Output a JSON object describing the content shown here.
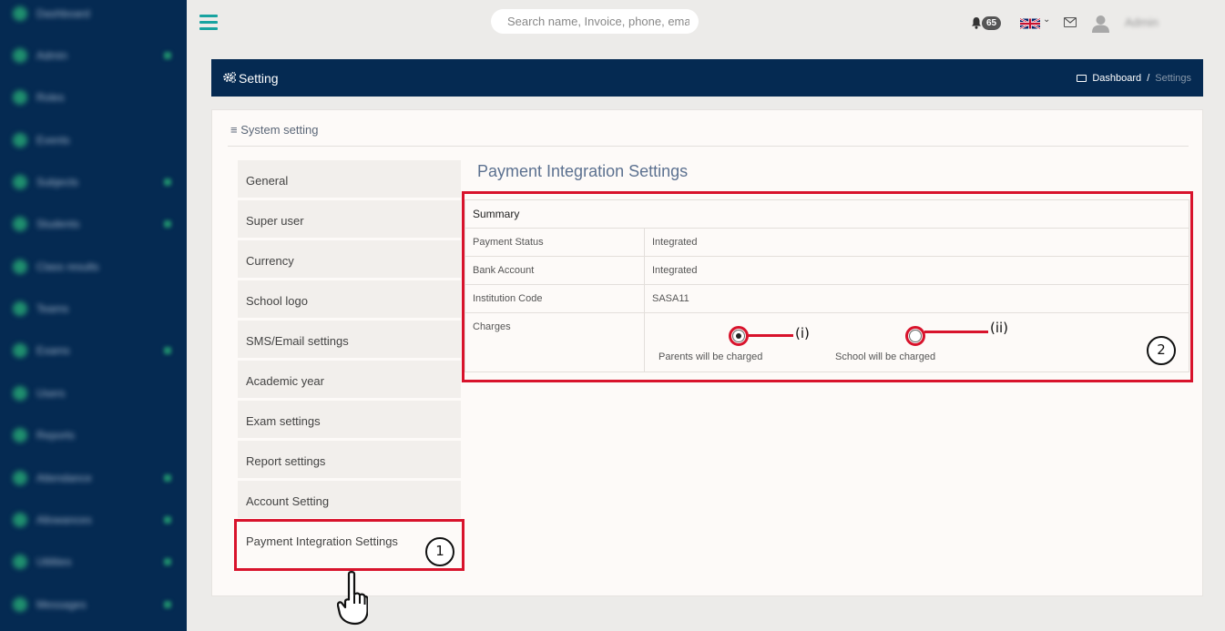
{
  "topbar": {
    "search_placeholder": "Search name, Invoice, phone, ema",
    "notification_count": "65",
    "user": "Admin"
  },
  "sidebar_items": [
    "Dashboard",
    "Admin",
    "Roles",
    "Events",
    "Subjects",
    "Students",
    "Class results",
    "Teams",
    "Exams",
    "Users",
    "Reports",
    "Attendance",
    "Allowances",
    "Utilities",
    "Messages"
  ],
  "header": {
    "title": "Setting",
    "breadcrumb_home": "Dashboard",
    "breadcrumb_sep": "/",
    "breadcrumb_current": "Settings"
  },
  "panel": {
    "title": "System setting"
  },
  "menu": [
    "General",
    "Super user",
    "Currency",
    "School logo",
    "SMS/Email settings",
    "Academic year",
    "Exam settings",
    "Report settings",
    "Account Setting",
    "Payment Integration Settings"
  ],
  "content": {
    "title": "Payment Integration Settings",
    "summary": "Summary",
    "rows": [
      {
        "label": "Payment Status",
        "value": "Integrated"
      },
      {
        "label": "Bank Account",
        "value": "Integrated"
      },
      {
        "label": "Institution Code",
        "value": "SASA11"
      }
    ],
    "charges_label": "Charges",
    "option_parents": "Parents will be charged",
    "option_school": "School will be charged",
    "selected_option": "Parents will be charged"
  },
  "annotations": {
    "step1": "1",
    "step2": "2",
    "option_i": "(i)",
    "option_ii": "(ii)"
  },
  "colors": {
    "sidebar": "#052a52",
    "accent": "#18a3a0",
    "highlight": "#d8132c"
  }
}
